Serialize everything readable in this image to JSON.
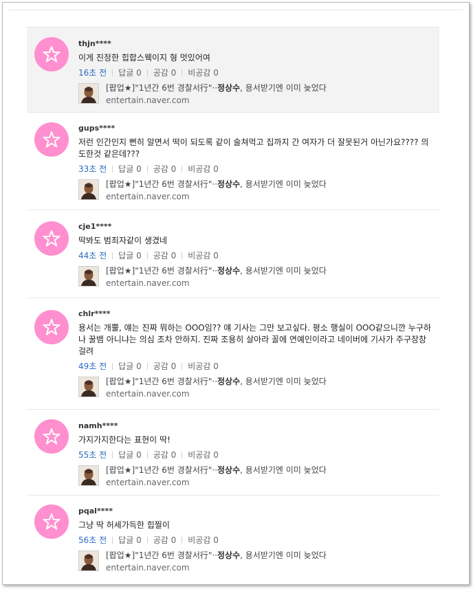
{
  "labels": {
    "reply": "답글",
    "like": "공감",
    "dislike": "비공감"
  },
  "comments": [
    {
      "user": "thjn****",
      "text": "이게 진정한 힙합스웩이지 형 멋있어여",
      "time": "16초 전",
      "replies": "0",
      "likes": "0",
      "dislikes": "0",
      "highlight": true,
      "article_prefix": "[팝업★]\"1년간 6번 경찰서行\"··",
      "article_name": "정상수",
      "article_suffix": ", 용서받기엔 이미 늦었다",
      "article_url": "entertain.naver.com"
    },
    {
      "user": "gups****",
      "text": "저런 인간인지 뻔히 알면서 떡이 되도록 같이 술쳐먹고 집까지 간 여자가 더 잘못된거 아닌가요???? 의도한것 같은데???",
      "time": "33초 전",
      "replies": "0",
      "likes": "0",
      "dislikes": "0",
      "highlight": false,
      "article_prefix": "[팝업★]\"1년간 6번 경찰서行\"··",
      "article_name": "정상수",
      "article_suffix": ", 용서받기엔 이미 늦었다",
      "article_url": "entertain.naver.com"
    },
    {
      "user": "cje1****",
      "text": "딱봐도 범죄자같이 생겼네",
      "time": "44초 전",
      "replies": "0",
      "likes": "0",
      "dislikes": "0",
      "highlight": false,
      "article_prefix": "[팝업★]\"1년간 6번 경찰서行\"··",
      "article_name": "정상수",
      "article_suffix": ", 용서받기엔 이미 늦었다",
      "article_url": "entertain.naver.com"
    },
    {
      "user": "chlr****",
      "text": "용서는 개뿔, 얘는 진짜 뭐하는 OOO임?? 얘 기사는 그만 보고싶다. 평소 행실이 OOO같으니깐 누구하나 꿀뱀 아니냐는 의심 조차 안하지. 진짜 조용히 살아라 꼴에 연예인이라고 네이버에 기사가 주구장창 걸려",
      "time": "49초 전",
      "replies": "0",
      "likes": "0",
      "dislikes": "0",
      "highlight": false,
      "article_prefix": "[팝업★]\"1년간 6번 경찰서行\"··",
      "article_name": "정상수",
      "article_suffix": ", 용서받기엔 이미 늦었다",
      "article_url": "entertain.naver.com"
    },
    {
      "user": "namh****",
      "text": "가지가지한다는 표현이 딱!",
      "time": "55초 전",
      "replies": "0",
      "likes": "0",
      "dislikes": "0",
      "highlight": false,
      "article_prefix": "[팝업★]\"1년간 6번 경찰서行\"··",
      "article_name": "정상수",
      "article_suffix": ", 용서받기엔 이미 늦었다",
      "article_url": "entertain.naver.com"
    },
    {
      "user": "pqal****",
      "text": "그냥 딱 허세가득한 힙찔이",
      "time": "56초 전",
      "replies": "0",
      "likes": "0",
      "dislikes": "0",
      "highlight": false,
      "article_prefix": "[팝업★]\"1년간 6번 경찰서行\"··",
      "article_name": "정상수",
      "article_suffix": ", 용서받기엔 이미 늦었다",
      "article_url": "entertain.naver.com"
    }
  ],
  "colors": {
    "avatar": "#ff8fcf",
    "time": "#2a6cc0",
    "highlight_bg": "#f3f3f3"
  }
}
